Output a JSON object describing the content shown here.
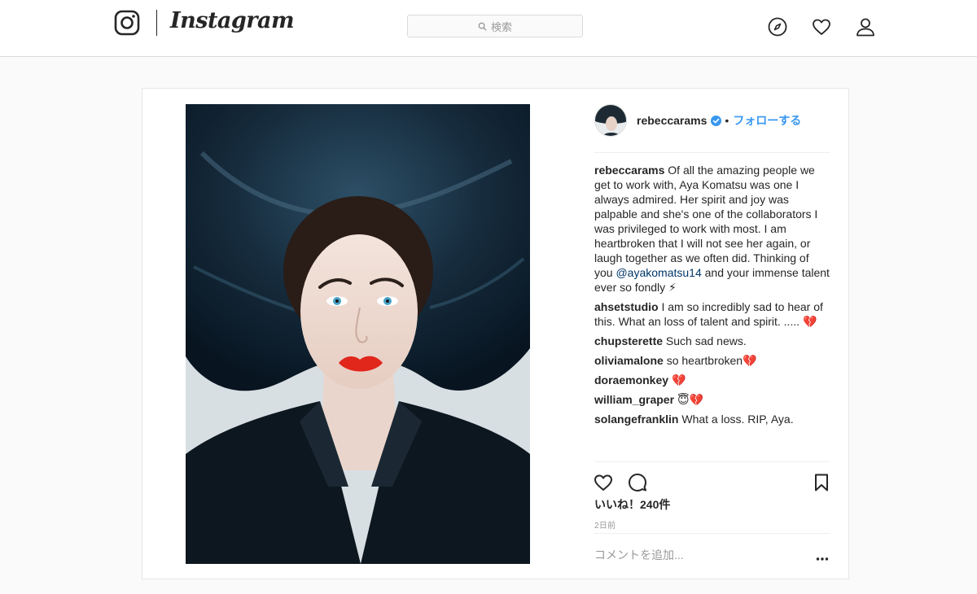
{
  "header": {
    "logo_text": "Instagram",
    "search_placeholder": "検索",
    "icons": [
      "instagram-glyph-icon",
      "search-icon",
      "compass-icon",
      "heart-icon",
      "profile-icon"
    ]
  },
  "post": {
    "author": "rebeccarams",
    "verified": true,
    "separator": "•",
    "follow_label": "フォローする",
    "caption": {
      "user": "rebeccarams",
      "text_before": "Of all the amazing people we get to work with, Aya Komatsu was one I always admired. Her spirit and joy was palpable and she's one of the collaborators I was privileged to work with most. I am heartbroken that I will not see her again, or laugh together as we often did. Thinking of you ",
      "mention": "@ayakomatsu14",
      "text_after": " and your immense talent ever so fondly ⚡"
    },
    "comments": [
      {
        "user": "ahsetstudio",
        "text": "I am so incredibly sad to hear of this. What an loss of talent and spirit. ..... 💔"
      },
      {
        "user": "chupsterette",
        "text": "Such sad news."
      },
      {
        "user": "oliviamalone",
        "text": "so heartbroken💔"
      },
      {
        "user": "doraemonkey",
        "text": "💔"
      },
      {
        "user": "william_graper",
        "text": "😇💔"
      },
      {
        "user": "solangefranklin",
        "text": "What a loss. RIP, Aya."
      }
    ],
    "likes_label": "いいね！240件",
    "timestamp": "2日前",
    "add_comment_placeholder": "コメントを追加...",
    "more_icon": "more-dots-icon"
  },
  "colors": {
    "link_blue": "#3897f0",
    "mention_blue": "#003569",
    "border": "#dbdbdb",
    "background": "#fafafa"
  }
}
